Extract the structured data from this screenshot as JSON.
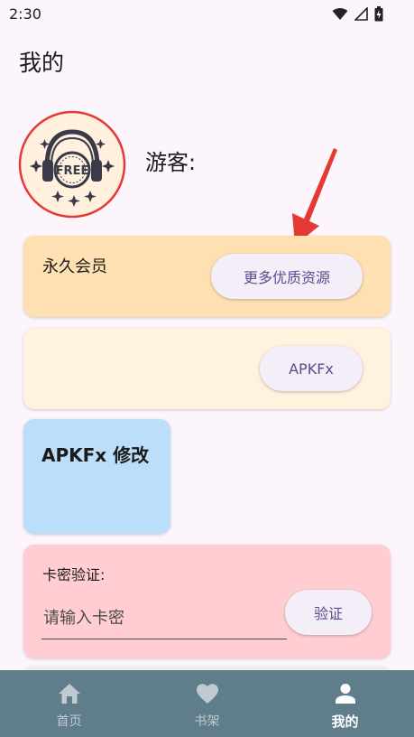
{
  "status_bar": {
    "time": "2:30"
  },
  "page": {
    "title": "我的"
  },
  "profile": {
    "avatar_badge": "FREE",
    "username": "游客:"
  },
  "cards": {
    "vip": {
      "label": "永久会员",
      "button_label": "更多优质资源"
    },
    "apkfx": {
      "button_label": "APKFx"
    },
    "mod": {
      "title": "APKFx 修改"
    },
    "card_key": {
      "label": "卡密验证:",
      "input_placeholder": "请输入卡密",
      "input_value": "",
      "verify_label": "验证"
    }
  },
  "bottom_nav": {
    "items": [
      {
        "label": "首页",
        "icon": "home-icon",
        "active": false
      },
      {
        "label": "书架",
        "icon": "heart-icon",
        "active": false
      },
      {
        "label": "我的",
        "icon": "person-icon",
        "active": true
      }
    ]
  },
  "colors": {
    "background": "#FCF5FC",
    "vip_card": "#FFE0B2",
    "apkfx_card": "#FFF2DF",
    "mod_card": "#BBDEFB",
    "key_card": "#FFCDD2",
    "nav_bar": "#607D8B",
    "button_text": "#5E4A8E",
    "arrow": "#E53935"
  }
}
